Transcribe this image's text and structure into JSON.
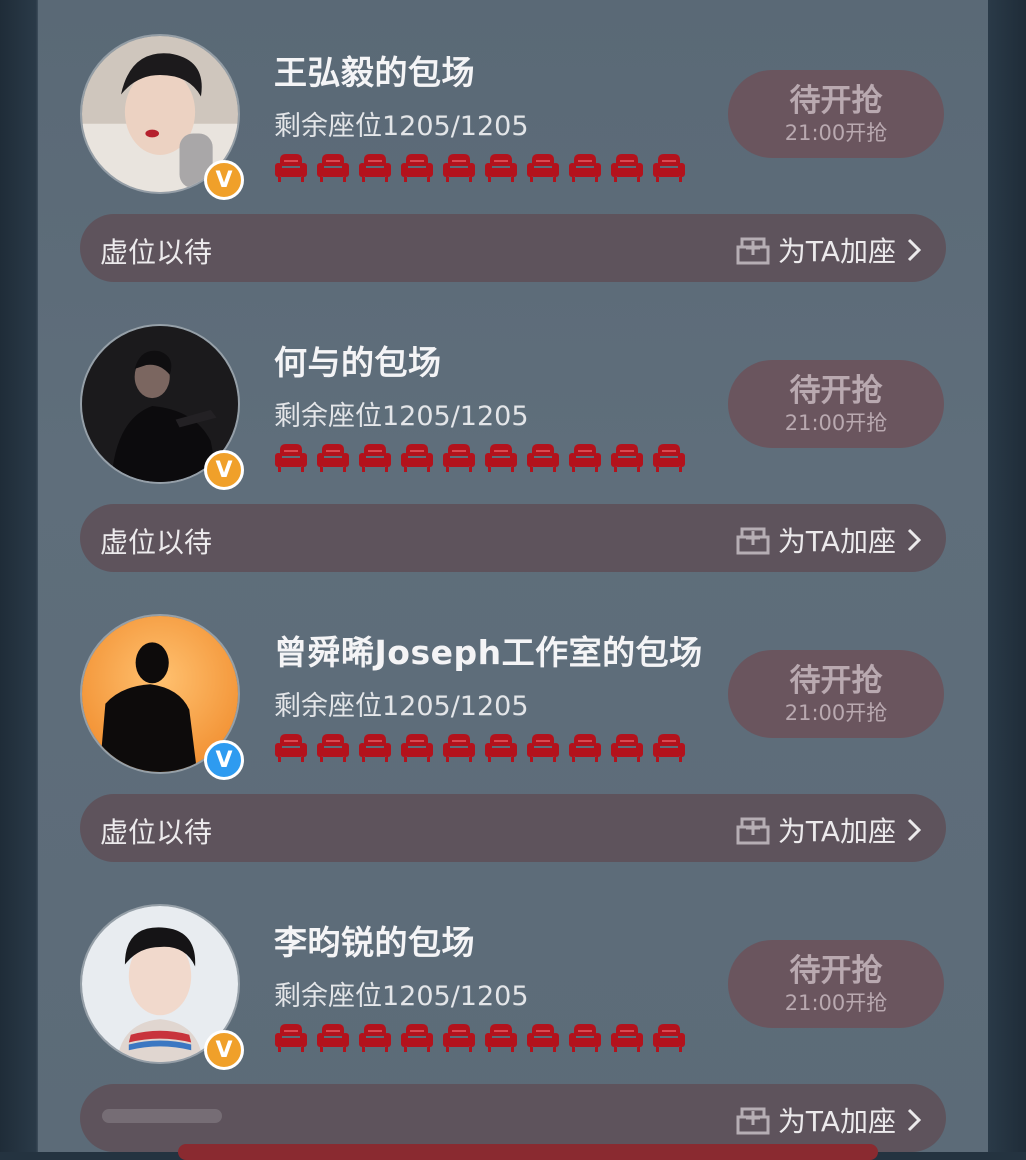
{
  "colors": {
    "panel_bg": "#5d6c79",
    "outer_bg": "#243340",
    "seat_red": "#b3121c",
    "button_bg": "#6a555e",
    "bar_bg": "#5e535c",
    "badge_orange": "#f0a02a",
    "badge_blue": "#2e9bf0"
  },
  "cards": [
    {
      "title": "王弘毅的包场",
      "seats_text": "剩余座位1205/1205",
      "button_main": "待开抢",
      "button_sub": "21:00开抢",
      "bar_left": "虚位以待",
      "bar_right": "为TA加座",
      "badge": "V",
      "badge_color": "orange"
    },
    {
      "title": "何与的包场",
      "seats_text": "剩余座位1205/1205",
      "button_main": "待开抢",
      "button_sub": "21:00开抢",
      "bar_left": "虚位以待",
      "bar_right": "为TA加座",
      "badge": "V",
      "badge_color": "orange"
    },
    {
      "title": "曾舜晞Joseph工作室的包场",
      "seats_text": "剩余座位1205/1205",
      "button_main": "待开抢",
      "button_sub": "21:00开抢",
      "bar_left": "虚位以待",
      "bar_right": "为TA加座",
      "badge": "V",
      "badge_color": "blue"
    },
    {
      "title": "李昀锐的包场",
      "seats_text": "剩余座位1205/1205",
      "button_main": "待开抢",
      "button_sub": "21:00开抢",
      "bar_left": "",
      "bar_right": "为TA加座",
      "badge": "V",
      "badge_color": "orange"
    }
  ],
  "seat_icon_count": 10,
  "icons": {
    "seat": "armchair-icon",
    "add_seat": "add-seat-icon",
    "chevron": "chevron-right-icon",
    "verified": "verified-v-badge-icon"
  }
}
